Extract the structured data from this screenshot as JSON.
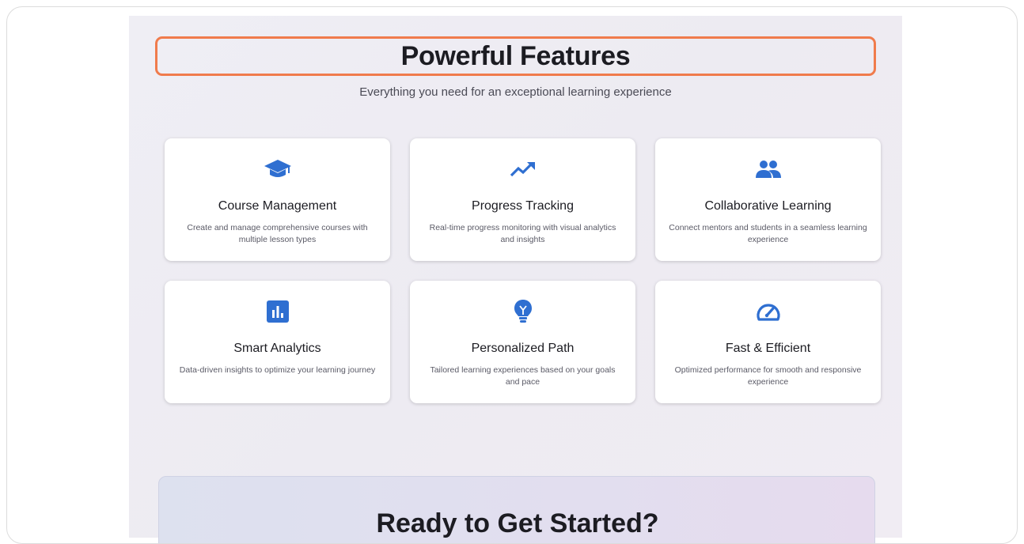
{
  "section": {
    "title": "Powerful Features",
    "subtitle": "Everything you need for an exceptional learning experience"
  },
  "accent_color": "#2f6fd1",
  "highlight_color": "#f07b4c",
  "features": [
    {
      "icon": "graduation-cap-icon",
      "title": "Course Management",
      "description": "Create and manage comprehensive courses with multiple lesson types"
    },
    {
      "icon": "trending-up-icon",
      "title": "Progress Tracking",
      "description": "Real-time progress monitoring with visual analytics and insights"
    },
    {
      "icon": "people-icon",
      "title": "Collaborative Learning",
      "description": "Connect mentors and students in a seamless learning experience"
    },
    {
      "icon": "bar-chart-icon",
      "title": "Smart Analytics",
      "description": "Data-driven insights to optimize your learning journey"
    },
    {
      "icon": "lightbulb-icon",
      "title": "Personalized Path",
      "description": "Tailored learning experiences based on your goals and pace"
    },
    {
      "icon": "speedometer-icon",
      "title": "Fast & Efficient",
      "description": "Optimized performance for smooth and responsive experience"
    }
  ],
  "cta": {
    "title": "Ready to Get Started?"
  }
}
